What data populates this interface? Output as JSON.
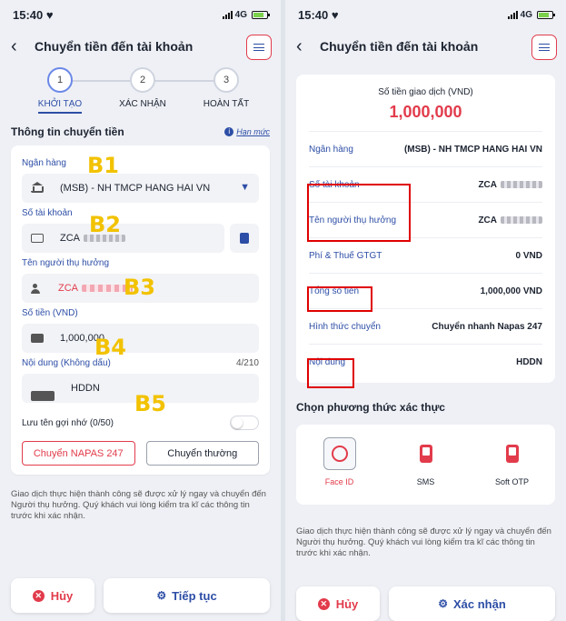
{
  "status": {
    "time": "15:40",
    "network": "4G"
  },
  "left": {
    "header": {
      "back": "‹",
      "title": "Chuyển tiền đến tài khoản"
    },
    "steps": [
      {
        "num": "1",
        "label": "KHỞI TẠO"
      },
      {
        "num": "2",
        "label": "XÁC NHẬN"
      },
      {
        "num": "3",
        "label": "HOÀN TẤT"
      }
    ],
    "section_title": "Thông tin chuyển tiền",
    "limit_link": "Hạn mức",
    "fields": {
      "bank_label": "Ngân hàng",
      "bank_value": "(MSB) - NH TMCP HANG HAI VN",
      "account_label": "Số tài khoản",
      "account_value": "ZCA",
      "receiver_label": "Tên người thụ hưởng",
      "receiver_value": "ZCA",
      "amount_label": "Số tiền (VND)",
      "amount_value": "1,000,000",
      "content_label": "Nội dung (Không dấu)",
      "content_count": "4/210",
      "content_value": "HDDN"
    },
    "markers": {
      "b1": "B1",
      "b2": "B2",
      "b3": "B3",
      "b4": "B4",
      "b5": "B5"
    },
    "save_alias": "Lưu tên gợi nhớ (0/50)",
    "transfer_types": {
      "napas": "Chuyển NAPAS 247",
      "normal": "Chuyển thường"
    },
    "note": "Giao dịch thực hiện thành công sẽ được xử lý ngay và chuyển đến Người thụ hưởng. Quý khách vui lòng kiểm tra kĩ các thông tin trước khi xác nhận.",
    "cancel": "Hủy",
    "next": "Tiếp tục"
  },
  "right": {
    "header": {
      "back": "‹",
      "title": "Chuyển tiền đến tài khoản"
    },
    "amount_label": "Số tiền giao dịch (VND)",
    "amount": "1,000,000",
    "rows": [
      {
        "key": "Ngân hàng",
        "value": "(MSB) - NH TMCP HANG HAI VN"
      },
      {
        "key": "Số tài khoản",
        "value": "ZCA"
      },
      {
        "key": "Tên người thụ hưởng",
        "value": "ZCA"
      },
      {
        "key": "Phí & Thuế GTGT",
        "value": "0 VND"
      },
      {
        "key": "Tổng số tiền",
        "value": "1,000,000 VND"
      },
      {
        "key": "Hình thức chuyển",
        "value": "Chuyển nhanh Napas 247"
      },
      {
        "key": "Nội dung",
        "value": "HDDN"
      }
    ],
    "auth_title": "Chọn phương thức xác thực",
    "auth_methods": [
      {
        "label": "Face ID",
        "icon": "face-id-icon"
      },
      {
        "label": "SMS",
        "icon": "sms-icon"
      },
      {
        "label": "Soft OTP",
        "icon": "soft-otp-icon"
      }
    ],
    "note": "Giao dịch thực hiện thành công sẽ được xử lý ngay và chuyển đến Người thụ hưởng. Quý khách vui lòng kiểm tra kĩ các thông tin trước khi xác nhận.",
    "cancel": "Hủy",
    "confirm": "Xác nhận"
  },
  "colors": {
    "accent": "#2d4ea6",
    "brand_red": "#e23b4b",
    "marker": "#f2c200",
    "highlight_box": "#e00000"
  }
}
